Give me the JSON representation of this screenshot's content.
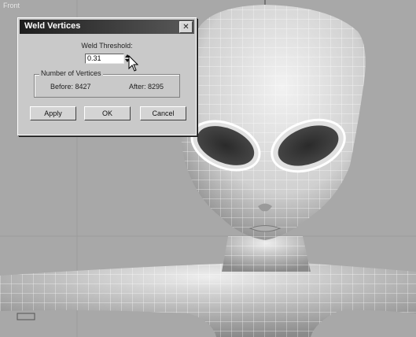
{
  "viewport": {
    "label": "Front"
  },
  "dialog": {
    "title": "Weld Vertices",
    "close_glyph": "✕",
    "threshold_label": "Weld Threshold:",
    "threshold_value": "0.31",
    "group_label": "Number of Vertices",
    "before_label": "Before: 8427",
    "after_label": "After: 8295",
    "apply_label": "Apply",
    "ok_label": "OK",
    "cancel_label": "Cancel"
  },
  "icons": [
    "close-icon",
    "spinner-up-icon",
    "spinner-down-icon",
    "mouse-cursor-icon"
  ]
}
